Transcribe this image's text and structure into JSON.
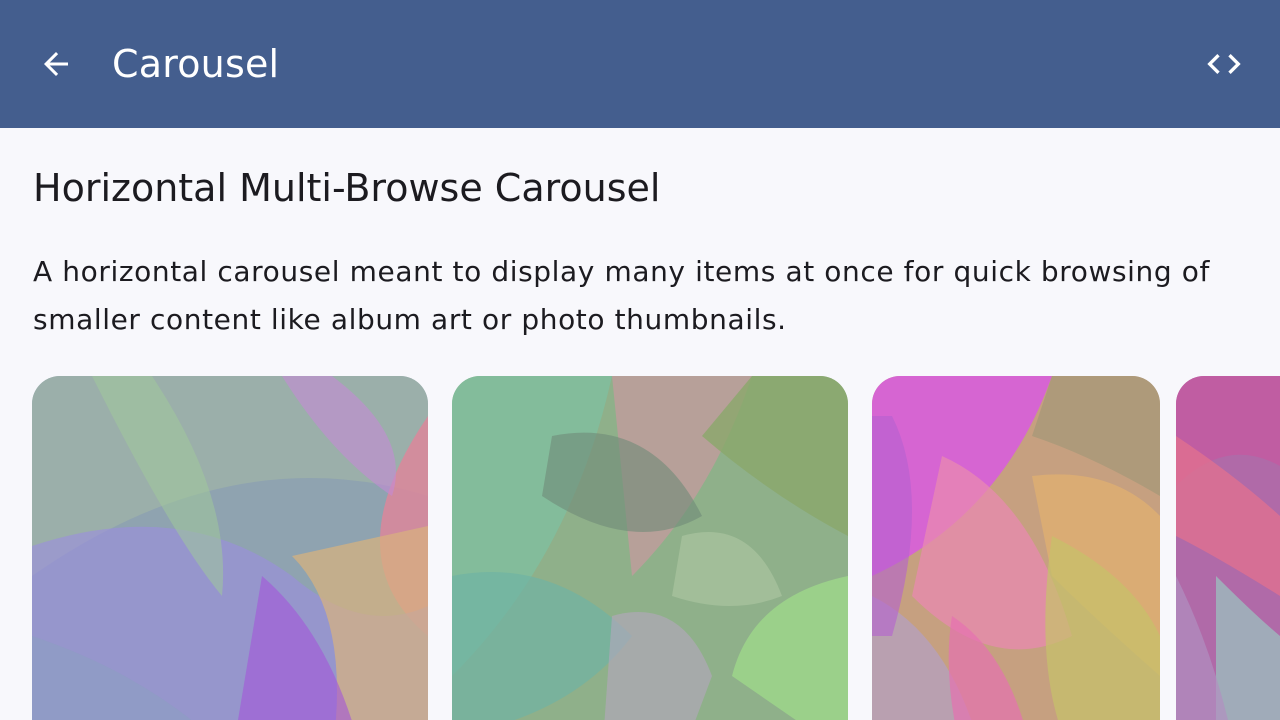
{
  "app_bar": {
    "title": "Carousel",
    "back_icon": "arrow-back-icon",
    "code_icon": "code-icon",
    "background": "#445e8e"
  },
  "section": {
    "title": "Horizontal Multi-Browse Carousel",
    "description": "A horizontal carousel meant to display many items at once for quick browsing of smaller content like album art or photo thumbnails."
  },
  "carousel": {
    "items": [
      {
        "name": "carousel-item-1",
        "palette": [
          "#8fa3b0",
          "#9b8ee0",
          "#c48ad6",
          "#e0849a",
          "#d9b27e",
          "#a0c89a"
        ]
      },
      {
        "name": "carousel-item-2",
        "palette": [
          "#7fc0a0",
          "#8aa86a",
          "#c79aa0",
          "#9ed88a",
          "#b6a6c0",
          "#6fb4a4"
        ]
      },
      {
        "name": "carousel-item-3",
        "palette": [
          "#d85ae0",
          "#e88ab0",
          "#c6c26a",
          "#e0b070",
          "#b0a0d0",
          "#a89878"
        ]
      },
      {
        "name": "carousel-item-4",
        "palette": [
          "#c45aa0",
          "#e07090",
          "#9ac8c0",
          "#b090c0"
        ]
      }
    ]
  }
}
